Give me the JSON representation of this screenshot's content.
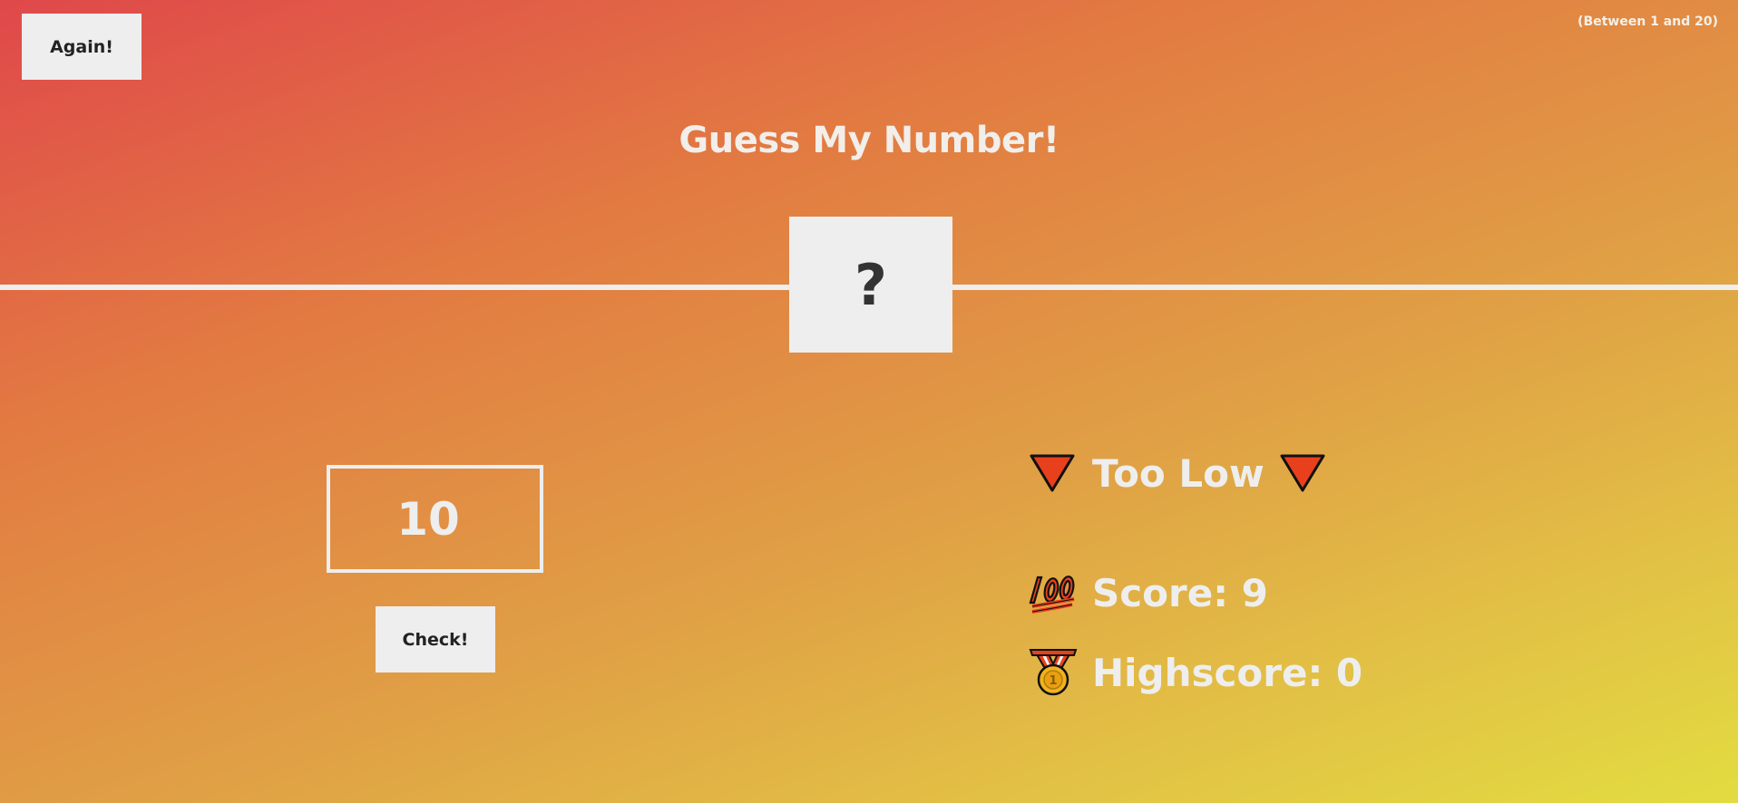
{
  "header": {
    "again_label": "Again!",
    "range_hint": "(Between 1 and 20)"
  },
  "title": "Guess My Number!",
  "secret_number": "?",
  "guess": {
    "value": "10"
  },
  "check_label": "Check!",
  "message": "Too Low",
  "score": "Score: 9",
  "highscore": "Highscore: 0",
  "icons": {
    "message": "down-triangle-icon",
    "score": "hundred-points-icon",
    "highscore": "medal-icon"
  },
  "colors": {
    "button_bg": "#eeeeee",
    "text_light": "#eeeeee",
    "text_dark": "#333333",
    "triangle_red": "#e8401c"
  }
}
